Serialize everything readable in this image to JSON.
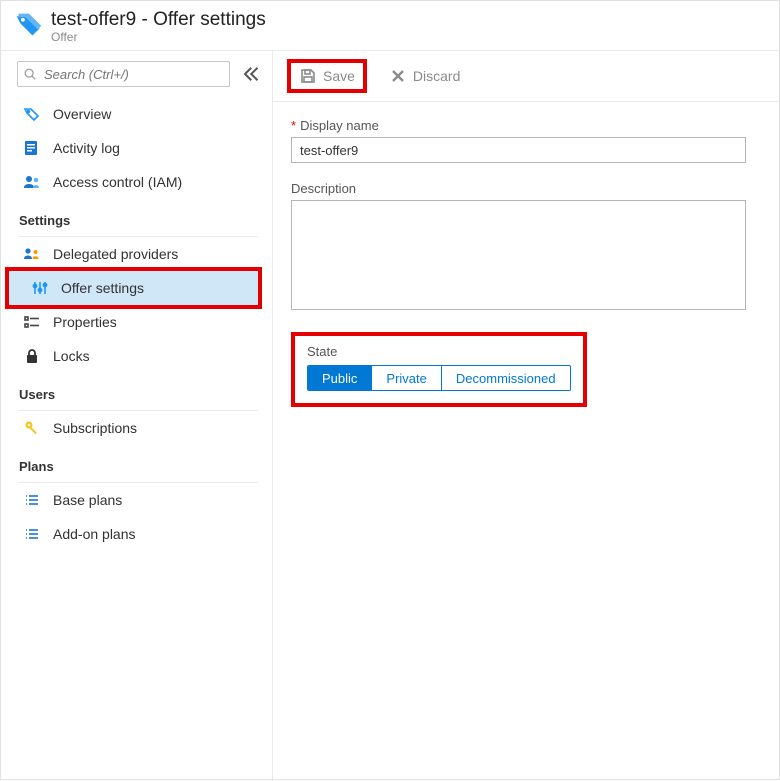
{
  "header": {
    "title": "test-offer9 - Offer settings",
    "subtitle": "Offer"
  },
  "search": {
    "placeholder": "Search (Ctrl+/)"
  },
  "nav": {
    "top": [
      {
        "icon": "overview",
        "label": "Overview"
      },
      {
        "icon": "activity",
        "label": "Activity log"
      },
      {
        "icon": "iam",
        "label": "Access control (IAM)"
      }
    ],
    "sections": {
      "settings_label": "Settings",
      "settings": [
        {
          "icon": "providers",
          "label": "Delegated providers"
        },
        {
          "icon": "sliders",
          "label": "Offer settings",
          "selected": true,
          "highlight": true
        },
        {
          "icon": "properties",
          "label": "Properties"
        },
        {
          "icon": "lock",
          "label": "Locks"
        }
      ],
      "users_label": "Users",
      "users": [
        {
          "icon": "key",
          "label": "Subscriptions"
        }
      ],
      "plans_label": "Plans",
      "plans": [
        {
          "icon": "list",
          "label": "Base plans"
        },
        {
          "icon": "list",
          "label": "Add-on plans"
        }
      ]
    }
  },
  "toolbar": {
    "save_label": "Save",
    "discard_label": "Discard"
  },
  "form": {
    "display_name_label": "Display name",
    "display_name_value": "test-offer9",
    "description_label": "Description",
    "description_value": "",
    "state_label": "State",
    "state_options": [
      "Public",
      "Private",
      "Decommissioned"
    ],
    "state_selected": "Public"
  }
}
